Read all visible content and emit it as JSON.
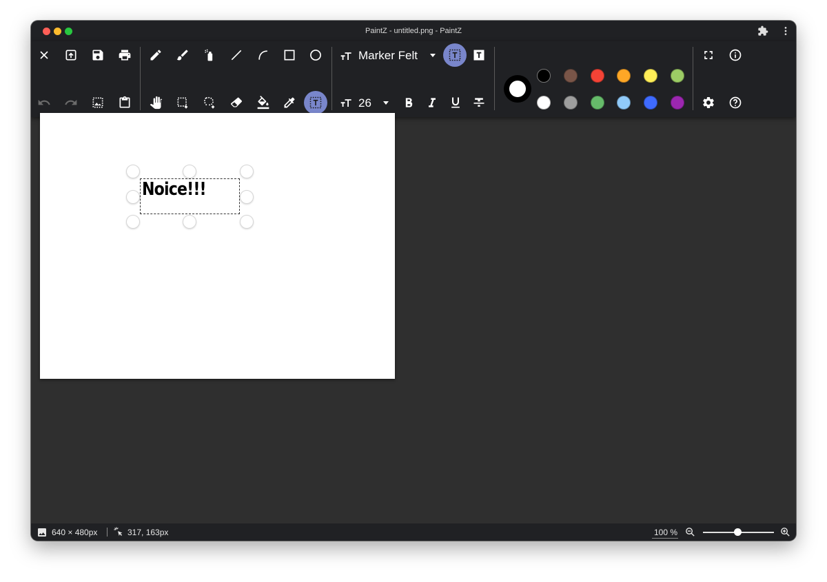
{
  "window": {
    "title": "PaintZ - untitled.png - PaintZ"
  },
  "toolbar": {
    "font_name": "Marker Felt",
    "font_size": "26",
    "colors": {
      "current": "#ffffff",
      "palette_row1": [
        "#000000",
        "#795548",
        "#f44336",
        "#ffa726",
        "#ffee58",
        "#9ccc65"
      ],
      "palette_row2": [
        "#ffffff",
        "#9e9e9e",
        "#66bb6a",
        "#90caf9",
        "#3f6bff",
        "#9c27b0"
      ],
      "accent": "#7986cb"
    }
  },
  "canvas": {
    "text": "Noice!!!"
  },
  "status": {
    "image_size": "640 × 480px",
    "cursor_position": "317, 163px",
    "zoom": "100 %"
  }
}
